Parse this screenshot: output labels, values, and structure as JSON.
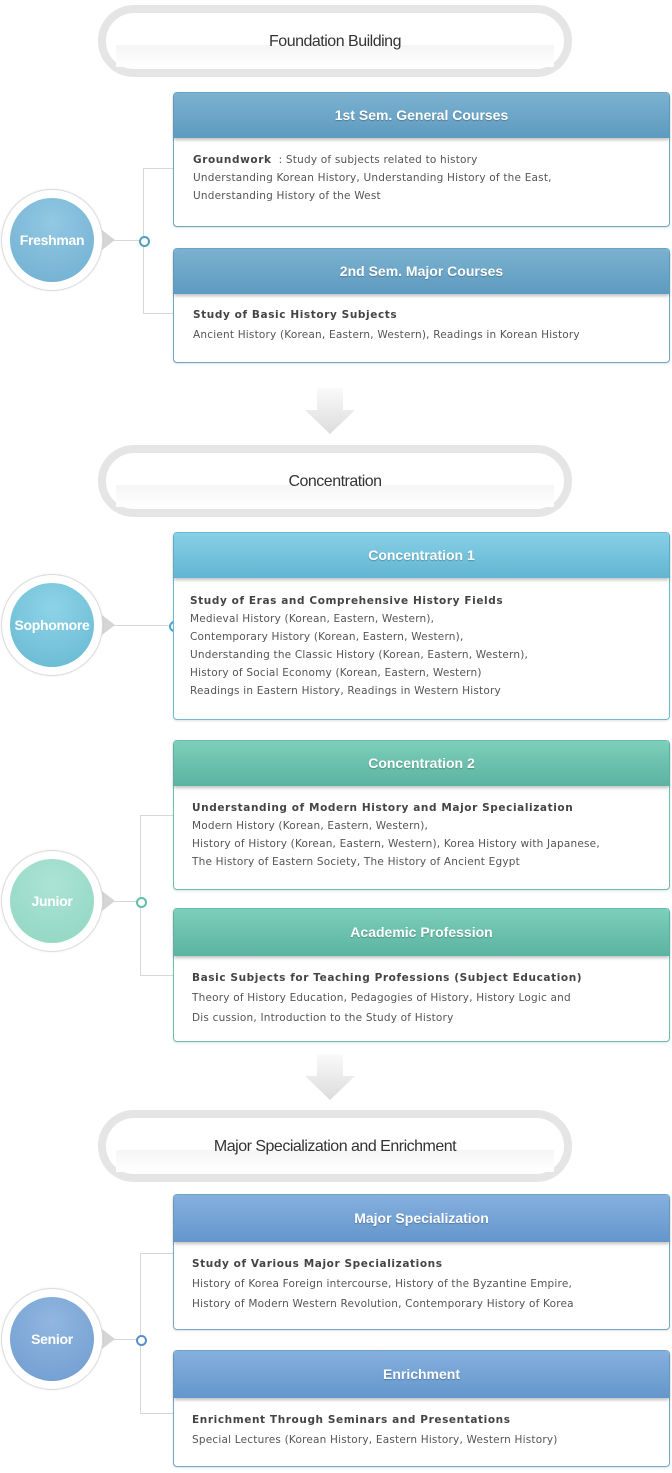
{
  "phases": [
    {
      "label": "Foundation Building"
    },
    {
      "label": "Concentration"
    },
    {
      "label": "Major Specialization and Enrichment"
    }
  ],
  "years": {
    "freshman": {
      "label": "Freshman",
      "color": "#7fbad8"
    },
    "sophomore": {
      "label": "Sophomore",
      "color": "#78c4dc"
    },
    "junior": {
      "label": "Junior",
      "color": "#9ddcc9"
    },
    "senior": {
      "label": "Senior",
      "color": "#7fa9d8"
    }
  },
  "cards": {
    "first_sem": {
      "header": "1st Sem. General Courses",
      "title": "Groundwork",
      "title_suffix": "  : Study of subjects related to history",
      "lines": [
        "Understanding Korean History, Understanding History of the East,",
        "Understanding History of the West"
      ]
    },
    "second_sem": {
      "header": "2nd Sem. Major Courses",
      "title": "Study of Basic History Subjects",
      "lines": [
        "Ancient History (Korean, Eastern, Western), Readings in Korean History"
      ]
    },
    "concentration1": {
      "header": "Concentration 1",
      "title": "Study of Eras and Comprehensive History Fields",
      "lines": [
        "Medieval History (Korean, Eastern, Western),",
        "Contemporary History (Korean, Eastern, Western),",
        "Understanding the Classic History (Korean, Eastern, Western),",
        "History of Social Economy (Korean, Eastern, Western)",
        "Readings in Eastern History, Readings in Western History"
      ]
    },
    "concentration2": {
      "header": "Concentration 2",
      "title": "Understanding of Modern History and Major Specialization",
      "lines": [
        "Modern History (Korean, Eastern, Western),",
        "History of History (Korean, Eastern, Western), Korea History with Japanese,",
        "The History of Eastern Society, The History of Ancient Egypt"
      ]
    },
    "academic": {
      "header": "Academic Profession",
      "title": "Basic Subjects for Teaching Professions (Subject Education)",
      "lines": [
        "Theory of History Education, Pedagogies of History, History Logic and",
        "Dis cussion, Introduction to the Study of History"
      ]
    },
    "major_spec": {
      "header": "Major Specialization",
      "title": "Study of Various Major Specializations",
      "lines": [
        "History of Korea Foreign intercourse, History of the Byzantine Empire,",
        "History of Modern Western Revolution, Contemporary History of Korea"
      ]
    },
    "enrichment": {
      "header": "Enrichment",
      "title": "Enrichment Through Seminars and Presentations",
      "lines": [
        "Special Lectures (Korean History, Eastern History, Western History)"
      ]
    }
  },
  "icons": {
    "down_arrow": "down-arrow-icon",
    "connector_dot": "connector-dot-icon"
  }
}
